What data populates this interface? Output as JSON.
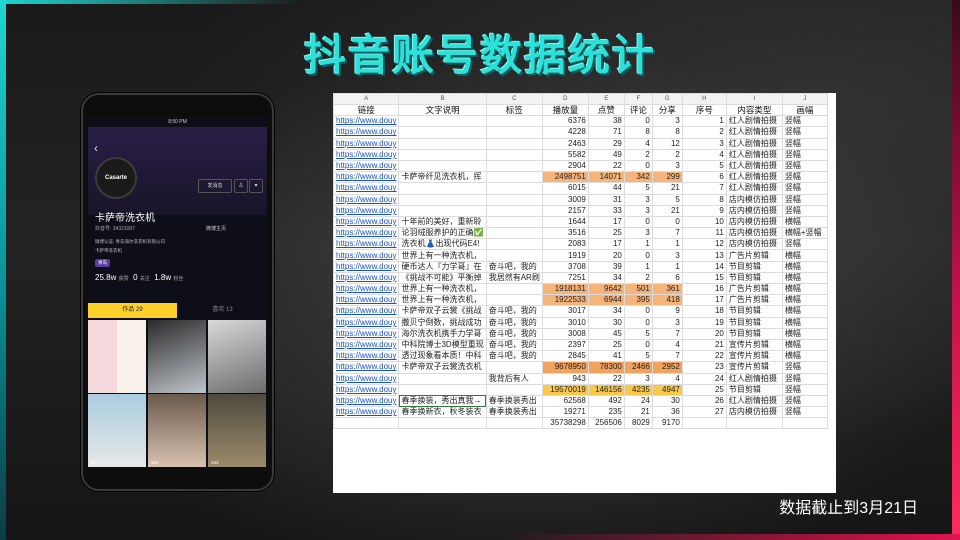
{
  "title": "抖音账号数据统计",
  "footnote": "数据截止到3月21日",
  "phone": {
    "status_time": "8:50 PM",
    "avatar_text": "Casarte",
    "send_message": "发消息",
    "username": "卡萨帝洗衣机",
    "douyin_id": "抖音号: 34321007",
    "weibo": "微博主页",
    "verified": "微博认证: 青岛海尔洗衣机有限公司",
    "description": "卡萨帝洗衣机",
    "tag": "青岛",
    "stats": [
      {
        "value": "25.8w",
        "label": "获赞"
      },
      {
        "value": "0",
        "label": "关注"
      },
      {
        "value": "1.8w",
        "label": "粉丝"
      }
    ],
    "tabs": {
      "works": "作品 29",
      "likes": "喜欢 13"
    },
    "grid_likes": [
      "",
      "",
      "",
      "97",
      "67",
      "",
      "133",
      "882",
      "183"
    ]
  },
  "sheet": {
    "col_letters": [
      "A",
      "B",
      "C",
      "D",
      "E",
      "F",
      "G",
      "H",
      "I",
      "J"
    ],
    "headers": [
      "链接",
      "文字说明",
      "标签",
      "播放量",
      "点赞",
      "评论",
      "分享",
      "序号",
      "内容类型",
      "画幅"
    ],
    "rows": [
      {
        "link": "https://www.douy",
        "desc": "",
        "tag": "",
        "plays": "6376",
        "likes": "38",
        "comments": "0",
        "shares": "3",
        "idx": "1",
        "type": "红人剧情拍摄",
        "format": "竖幅"
      },
      {
        "link": "https://www.douy",
        "desc": "",
        "tag": "",
        "plays": "4228",
        "likes": "71",
        "comments": "8",
        "shares": "8",
        "idx": "2",
        "type": "红人剧情拍摄",
        "format": "竖幅"
      },
      {
        "link": "https://www.douy",
        "desc": "",
        "tag": "",
        "plays": "2463",
        "likes": "29",
        "comments": "4",
        "shares": "12",
        "idx": "3",
        "type": "红人剧情拍摄",
        "format": "竖幅"
      },
      {
        "link": "https://www.douy",
        "desc": "",
        "tag": "",
        "plays": "5582",
        "likes": "49",
        "comments": "2",
        "shares": "2",
        "idx": "4",
        "type": "红人剧情拍摄",
        "format": "竖幅"
      },
      {
        "link": "https://www.douy",
        "desc": "",
        "tag": "",
        "plays": "2904",
        "likes": "22",
        "comments": "0",
        "shares": "3",
        "idx": "5",
        "type": "红人剧情拍摄",
        "format": "竖幅"
      },
      {
        "link": "https://www.douy",
        "desc": "卡萨帝纤见洗衣机，挥",
        "tag": "",
        "plays": "2498751",
        "likes": "14071",
        "comments": "342",
        "shares": "299",
        "idx": "6",
        "type": "红人剧情拍摄",
        "format": "竖幅",
        "hl": "orange"
      },
      {
        "link": "https://www.douy",
        "desc": "",
        "tag": "",
        "plays": "6015",
        "likes": "44",
        "comments": "5",
        "shares": "21",
        "idx": "7",
        "type": "红人剧情拍摄",
        "format": "竖幅"
      },
      {
        "link": "https://www.douy",
        "desc": "",
        "tag": "",
        "plays": "3009",
        "likes": "31",
        "comments": "3",
        "shares": "5",
        "idx": "8",
        "type": "店内模仿拍摄",
        "format": "竖幅"
      },
      {
        "link": "https://www.douy",
        "desc": "",
        "tag": "",
        "plays": "2157",
        "likes": "33",
        "comments": "3",
        "shares": "21",
        "idx": "9",
        "type": "店内模仿拍摄",
        "format": "竖幅"
      },
      {
        "link": "https://www.douy",
        "desc": "十年前的美好，重新聆",
        "tag": "",
        "plays": "1644",
        "likes": "17",
        "comments": "0",
        "shares": "0",
        "idx": "10",
        "type": "店内模仿拍摄",
        "format": "横幅"
      },
      {
        "link": "https://www.douy",
        "desc": "论羽绒服养护的正确✅",
        "tag": "",
        "plays": "3516",
        "likes": "25",
        "comments": "3",
        "shares": "7",
        "idx": "11",
        "type": "店内模仿拍摄",
        "format": "横幅+竖幅"
      },
      {
        "link": "https://www.douy",
        "desc": "洗衣机👗出现代码E4!",
        "tag": "",
        "plays": "2083",
        "likes": "17",
        "comments": "1",
        "shares": "1",
        "idx": "12",
        "type": "店内模仿拍摄",
        "format": "竖幅"
      },
      {
        "link": "https://www.douy",
        "desc": "世界上有一种洗衣机，",
        "tag": "",
        "plays": "1919",
        "likes": "20",
        "comments": "0",
        "shares": "3",
        "idx": "13",
        "type": "广告片剪辑",
        "format": "横幅"
      },
      {
        "link": "https://www.douy",
        "desc": "硬币达人『力学哥』在",
        "tag": "奋斗吧，我的",
        "plays": "3708",
        "likes": "39",
        "comments": "1",
        "shares": "1",
        "idx": "14",
        "type": "节目剪辑",
        "format": "横幅"
      },
      {
        "link": "https://www.douy",
        "desc": "《挑战不可能》平衡掉",
        "tag": "我居然有AR刷",
        "plays": "7251",
        "likes": "34",
        "comments": "2",
        "shares": "6",
        "idx": "15",
        "type": "节目剪辑",
        "format": "横幅"
      },
      {
        "link": "https://www.douy",
        "desc": "世界上有一种洗衣机，",
        "tag": "",
        "plays": "1918131",
        "likes": "9642",
        "comments": "501",
        "shares": "361",
        "idx": "16",
        "type": "广告片剪辑",
        "format": "横幅",
        "hl": "orange"
      },
      {
        "link": "https://www.douy",
        "desc": "世界上有一种洗衣机，",
        "tag": "",
        "plays": "1922533",
        "likes": "6944",
        "comments": "395",
        "shares": "418",
        "idx": "17",
        "type": "广告片剪辑",
        "format": "横幅",
        "hl": "orange"
      },
      {
        "link": "https://www.douy",
        "desc": "卡萨帝双子云裳《挑战",
        "tag": "奋斗吧，我的",
        "plays": "3017",
        "likes": "34",
        "comments": "0",
        "shares": "9",
        "idx": "18",
        "type": "节目剪辑",
        "format": "横幅"
      },
      {
        "link": "https://www.douy",
        "desc": "撒贝宁倒数，挑战成功",
        "tag": "奋斗吧，我的",
        "plays": "3010",
        "likes": "30",
        "comments": "0",
        "shares": "3",
        "idx": "19",
        "type": "节目剪辑",
        "format": "横幅"
      },
      {
        "link": "https://www.douy",
        "desc": "海尔洗衣机携手力学哥",
        "tag": "奋斗吧，我的",
        "plays": "3008",
        "likes": "45",
        "comments": "5",
        "shares": "7",
        "idx": "20",
        "type": "节目剪辑",
        "format": "横幅"
      },
      {
        "link": "https://www.douy",
        "desc": "中科院博士3D模型重现",
        "tag": "奋斗吧，我的",
        "plays": "2397",
        "likes": "25",
        "comments": "0",
        "shares": "4",
        "idx": "21",
        "type": "宣传片剪辑",
        "format": "横幅"
      },
      {
        "link": "https://www.douy",
        "desc": "透过现象看本质！中科",
        "tag": "奋斗吧，我的",
        "plays": "2845",
        "likes": "41",
        "comments": "5",
        "shares": "7",
        "idx": "22",
        "type": "宣传片剪辑",
        "format": "横幅"
      },
      {
        "link": "https://www.douy",
        "desc": "卡萨帝双子云裳洗衣机",
        "tag": "",
        "plays": "9678950",
        "likes": "78300",
        "comments": "2466",
        "shares": "2952",
        "idx": "23",
        "type": "宣传片剪辑",
        "format": "竖幅",
        "hl": "orange-dark"
      },
      {
        "link": "https://www.douy",
        "desc": "",
        "tag": "我背后有人",
        "plays": "943",
        "likes": "22",
        "comments": "3",
        "shares": "4",
        "idx": "24",
        "type": "红人剧情拍摄",
        "format": "竖幅"
      },
      {
        "link": "https://www.douy",
        "desc": "",
        "tag": "",
        "plays": "19570019",
        "likes": "146156",
        "comments": "4235",
        "shares": "4947",
        "idx": "25",
        "type": "节目剪辑",
        "format": "竖幅",
        "hl": "gold"
      },
      {
        "link": "https://www.douy",
        "desc": "春季换装，秀出真我→",
        "tag": "春季换装秀出",
        "plays": "62568",
        "likes": "492",
        "comments": "24",
        "shares": "30",
        "idx": "26",
        "type": "红人剧情拍摄",
        "format": "竖幅",
        "sel": true
      },
      {
        "link": "https://www.douy",
        "desc": "春季换新衣，秋冬装衣",
        "tag": "春季换装秀出",
        "plays": "19271",
        "likes": "235",
        "comments": "21",
        "shares": "36",
        "idx": "27",
        "type": "店内模仿拍摄",
        "format": "竖幅"
      }
    ],
    "totals": {
      "plays": "35738298",
      "likes": "256506",
      "comments": "8029",
      "shares": "9170"
    }
  },
  "colors": {
    "title": "#2de0d8",
    "highlight_orange": "#f5b47a",
    "highlight_gold": "#f7c84c",
    "link": "#1a53c8"
  }
}
